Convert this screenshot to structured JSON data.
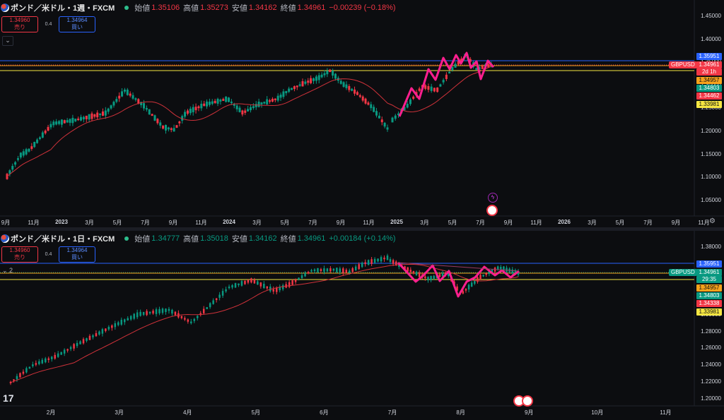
{
  "symbol": {
    "name": "ポンド／米ドル",
    "broker": "FXCM"
  },
  "colors": {
    "up": "#089981",
    "down": "#f23645",
    "ma": "#d0323a",
    "pattern": "#ff1f8e",
    "bg": "#0c0d10"
  },
  "top": {
    "timeframe": "1週",
    "ohlc": {
      "open_label": "始値",
      "open": "1.35106",
      "high_label": "高値",
      "high": "1.35273",
      "low_label": "安値",
      "low": "1.34162",
      "close_label": "終値",
      "close": "1.34961",
      "change": "−0.00239 (−0.18%)"
    },
    "sell": {
      "price": "1.34960",
      "label": "売り"
    },
    "buy": {
      "price": "1.34964",
      "label": "買い"
    },
    "spread": "0.4",
    "collapse_icon": "chevron-down-icon",
    "y_ticks": [
      "1.45000",
      "1.40000",
      "1.35000",
      "1.30000",
      "1.25000",
      "1.20000",
      "1.15000",
      "1.10000",
      "1.05000"
    ],
    "x_ticks": [
      "9月",
      "11月",
      "2023",
      "3月",
      "5月",
      "7月",
      "9月",
      "11月",
      "2024",
      "3月",
      "5月",
      "7月",
      "9月",
      "11月",
      "2025",
      "3月",
      "5月",
      "7月",
      "9月",
      "11月",
      "2026",
      "3月",
      "5月",
      "7月",
      "9月",
      "11月"
    ],
    "symbol_tag": "GBPUSD",
    "tags": {
      "blue": "1.35951",
      "last": "1.34961",
      "countdown": "2d 1h",
      "orange": "1.34957",
      "green": "1.34803",
      "red": "1.34462",
      "yellow": "1.33981"
    }
  },
  "bottom": {
    "timeframe": "1日",
    "ohlc": {
      "open_label": "始値",
      "open": "1.34777",
      "high_label": "高値",
      "high": "1.35018",
      "low_label": "安値",
      "low": "1.34162",
      "close_label": "終値",
      "close": "1.34961",
      "change": "+0.00184 (+0.14%)"
    },
    "sell": {
      "price": "1.34960",
      "label": "売り"
    },
    "buy": {
      "price": "1.34964",
      "label": "買い"
    },
    "spread": "0.4",
    "collapse_label": "2",
    "y_ticks": [
      "1.38000",
      "1.36000",
      "1.34000",
      "1.32000",
      "1.30000",
      "1.28000",
      "1.26000",
      "1.24000",
      "1.22000",
      "1.20000"
    ],
    "x_ticks": [
      "2月",
      "3月",
      "4月",
      "5月",
      "6月",
      "7月",
      "8月",
      "9月",
      "10月",
      "11月"
    ],
    "symbol_tag": "GBPUSD",
    "tags": {
      "blue": "1.35951",
      "last": "1.34961",
      "countdown": "29:35",
      "orange": "1.34957",
      "green": "1.34803",
      "red": "1.34338",
      "yellow": "1.33981"
    }
  },
  "logo": "17"
}
